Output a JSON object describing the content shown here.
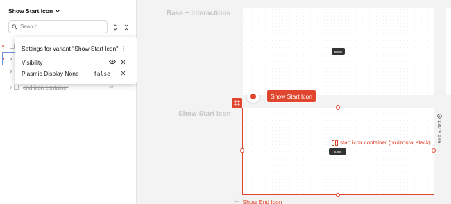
{
  "left_panel": {
    "variant_title": "Show Start Icon",
    "search_placeholder": "Search...",
    "tree_items": [
      {
        "label": "end icon container"
      }
    ]
  },
  "popover": {
    "title": "Settings for variant \"Show Start Icon\"",
    "rows": [
      {
        "label": "Visibility"
      },
      {
        "label": "Plasmic Display None",
        "value": "false"
      }
    ]
  },
  "canvas": {
    "frame_labels": [
      "Base + Interactions",
      "Show Start Icon"
    ],
    "mini_buttons": [
      "Button",
      "Button"
    ],
    "active_variant": "Show Start Icon",
    "selection_label": "start icon container (horizontal stack)",
    "dimensions": "180 × 546",
    "next_variant": "Show End Icon"
  },
  "colors": {
    "accent": "#e0452d",
    "selection_border": "#6f8fd8"
  },
  "icons": [
    "chevron-down-icon",
    "search-icon",
    "sort-icon",
    "collapse-icon",
    "menu-dots-icon",
    "eye-icon",
    "close-icon",
    "record-icon",
    "frame-icon",
    "hstack-icon",
    "dimension-icon"
  ]
}
